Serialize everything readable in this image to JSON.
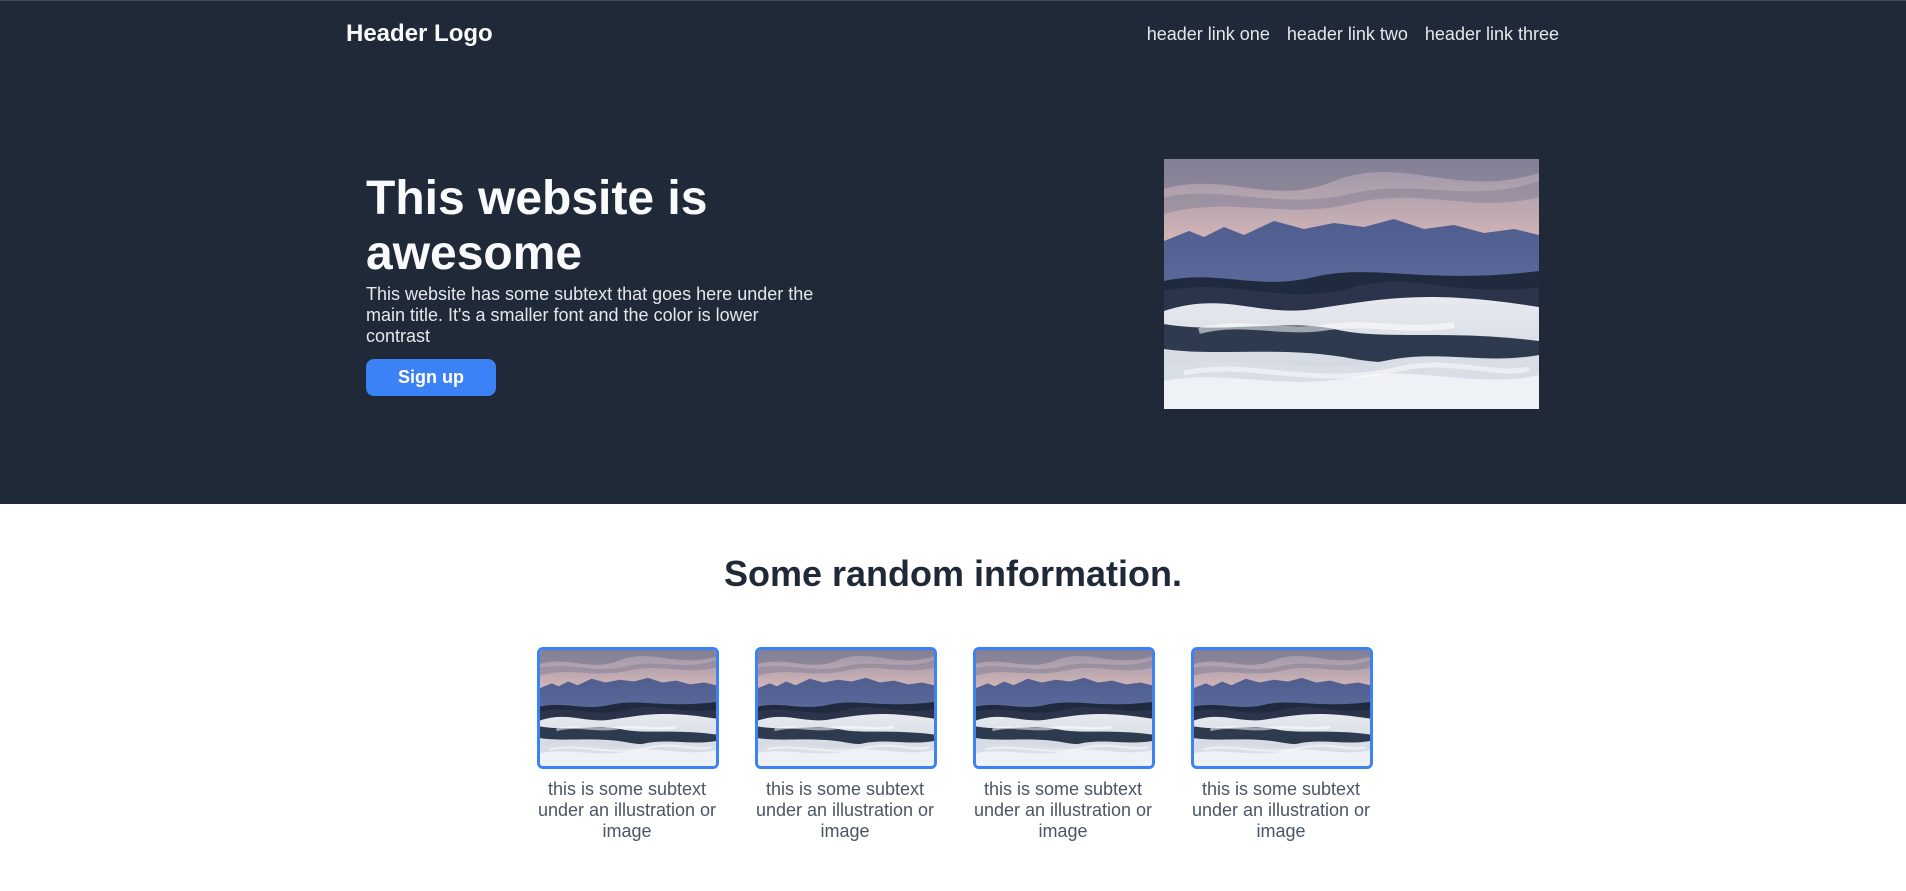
{
  "header": {
    "logo": "Header Logo",
    "links": [
      "header link one",
      "header link two",
      "header link three"
    ]
  },
  "hero": {
    "title": "This website is awesome",
    "subtext": "This website has some subtext that goes here under the main title. It's a smaller font and the color is lower contrast",
    "button_label": "Sign up"
  },
  "info": {
    "title": "Some random information.",
    "cards": [
      {
        "text": "this is some subtext under an illustration or image"
      },
      {
        "text": "this is some subtext under an illustration or image"
      },
      {
        "text": "this is some subtext under an illustration or image"
      },
      {
        "text": "this is some subtext under an illustration or image"
      }
    ]
  },
  "colors": {
    "header_bg": "#1f2937",
    "accent": "#3b82f6",
    "subtext": "#4b5563"
  },
  "icons": {
    "hero_image": "desert-dunes-landscape-image",
    "card_image": "desert-dunes-landscape-image"
  }
}
